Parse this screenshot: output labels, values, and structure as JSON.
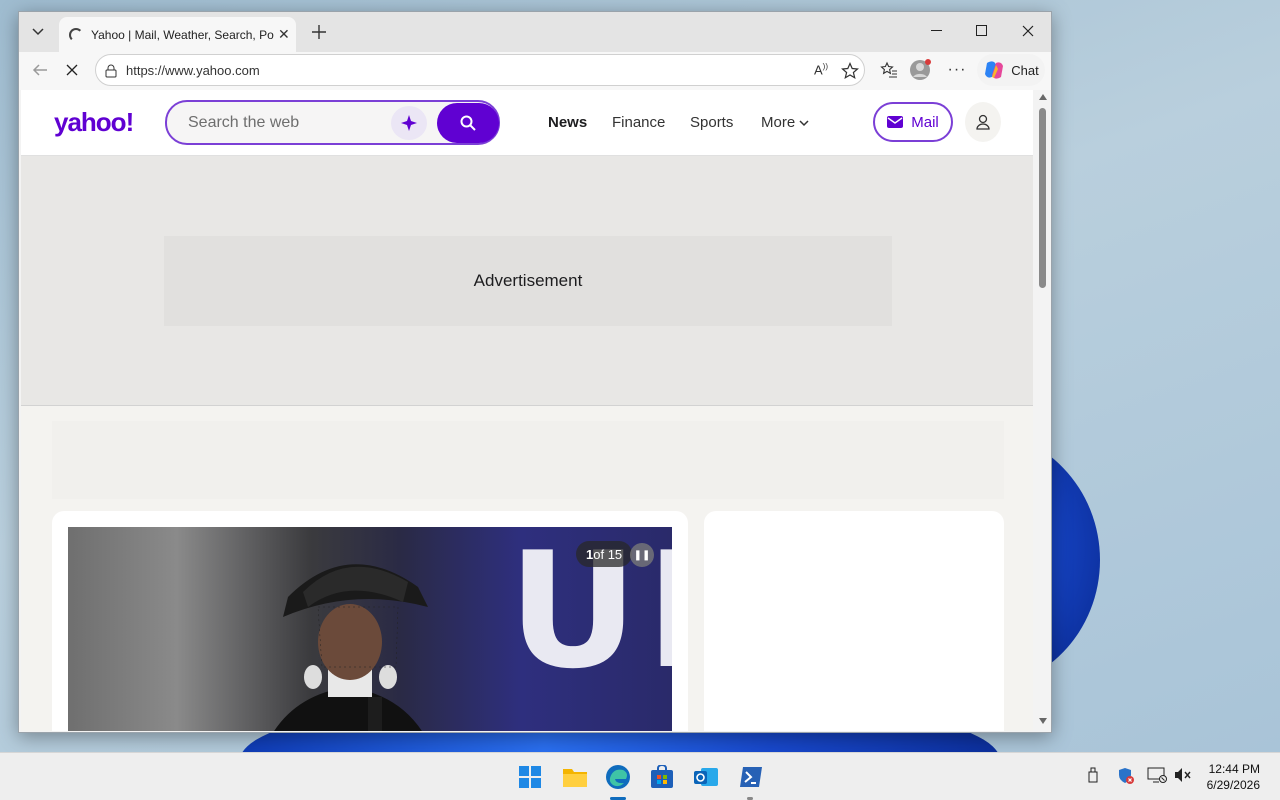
{
  "browser": {
    "tab_title": "Yahoo | Mail, Weather, Search, Politics, News, Finance, Sports & Videos",
    "url": "https://www.yahoo.com",
    "chat_label": "Chat"
  },
  "yahoo": {
    "logo": "yahoo!",
    "search_placeholder": "Search the web",
    "nav": [
      "News",
      "Finance",
      "Sports",
      "More"
    ],
    "mail_label": "Mail",
    "ad_label": "Advertisement",
    "slideshow_counter_current": "1",
    "slideshow_counter_rest": " of 15"
  },
  "taskbar": {
    "time": "12:44 PM",
    "date": "6/29/2026"
  },
  "colors": {
    "yahoo_purple": "#6001d2",
    "edge_blue": "#0f6cbd"
  }
}
